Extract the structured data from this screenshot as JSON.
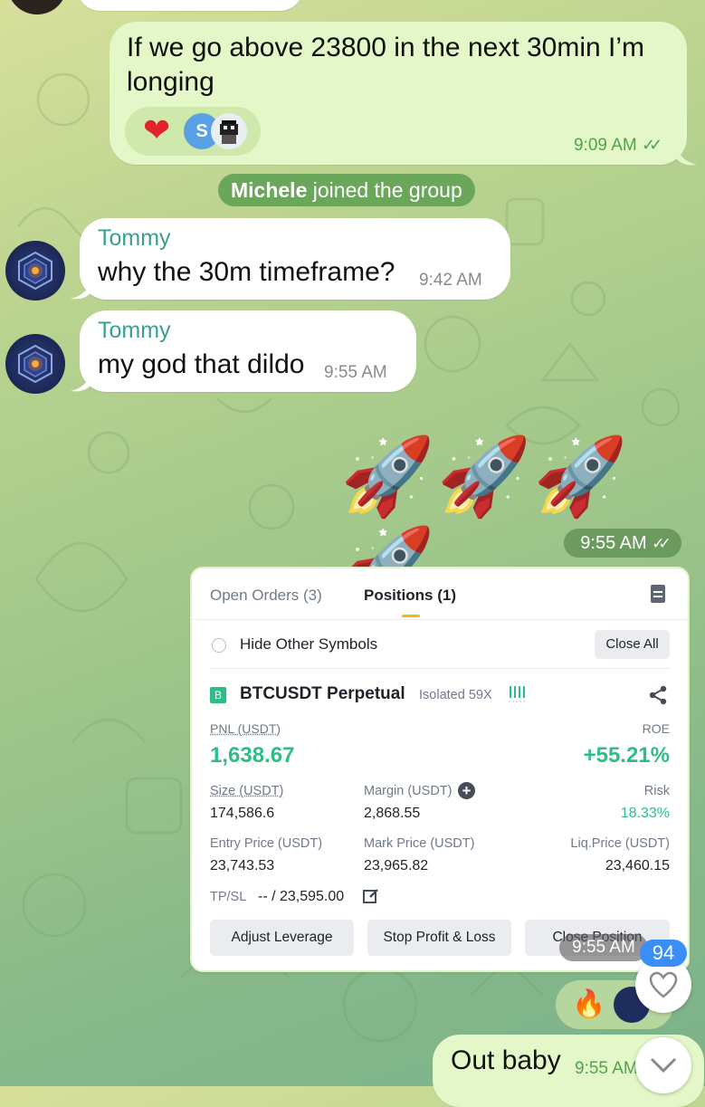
{
  "messages": {
    "m1": {
      "text": "If we go above 23800 in the next 30min I’m longing",
      "time": "9:09 AM",
      "reactions": [
        {
          "icon": "heart-icon",
          "glyph": "❤"
        },
        {
          "icon": "user-avatar-s",
          "label": "S"
        },
        {
          "icon": "user-avatar-pixel",
          "label": ""
        }
      ]
    },
    "service": {
      "name": "Michele",
      "action": "joined the group"
    },
    "m2": {
      "sender": "Tommy",
      "text": "why the 30m timeframe?",
      "time": "9:42 AM"
    },
    "m3": {
      "sender": "Tommy",
      "text": "my god that dildo",
      "time": "9:55 AM"
    },
    "m4": {
      "emoji": "🚀🚀🚀🚀",
      "time": "9:55 AM"
    },
    "m5": {
      "time": "9:55 AM",
      "reactions": [
        "🔥"
      ],
      "screenshot": {
        "tabs": [
          "Open Orders (3)",
          "Positions (1)"
        ],
        "active_tab": "Positions (1)",
        "hide_label": "Hide Other Symbols",
        "close_all": "Close All",
        "symbol_badge": "B",
        "symbol": "BTCUSDT Perpetual",
        "margin_mode": "Isolated 59X",
        "pnl_label": "PNL (USDT)",
        "pnl_value": "1,638.67",
        "roe_label": "ROE",
        "roe_value": "+55.21%",
        "size_label": "Size (USDT)",
        "size_value": "174,586.6",
        "margin_label": "Margin (USDT)",
        "margin_value": "2,868.55",
        "risk_label": "Risk",
        "risk_value": "18.33%",
        "entry_label": "Entry Price (USDT)",
        "entry_value": "23,743.53",
        "mark_label": "Mark Price (USDT)",
        "mark_value": "23,965.82",
        "liq_label": "Liq.Price (USDT)",
        "liq_value": "23,460.15",
        "tpsl_label": "TP/SL",
        "tpsl_value": "-- / 23,595.00",
        "buttons": [
          "Adjust Leverage",
          "Stop Profit & Loss",
          "Close Position"
        ]
      }
    },
    "m6": {
      "text": "Out baby",
      "time": "9:55 AM"
    }
  },
  "floating": {
    "unread_count": "94"
  },
  "colors": {
    "outgoing_bubble": "#e3f7c8",
    "sender_name": "#3b9f8f",
    "time_out": "#4fa54a",
    "profit_green": "#2ebd85",
    "badge_blue": "#3a8ef6"
  }
}
